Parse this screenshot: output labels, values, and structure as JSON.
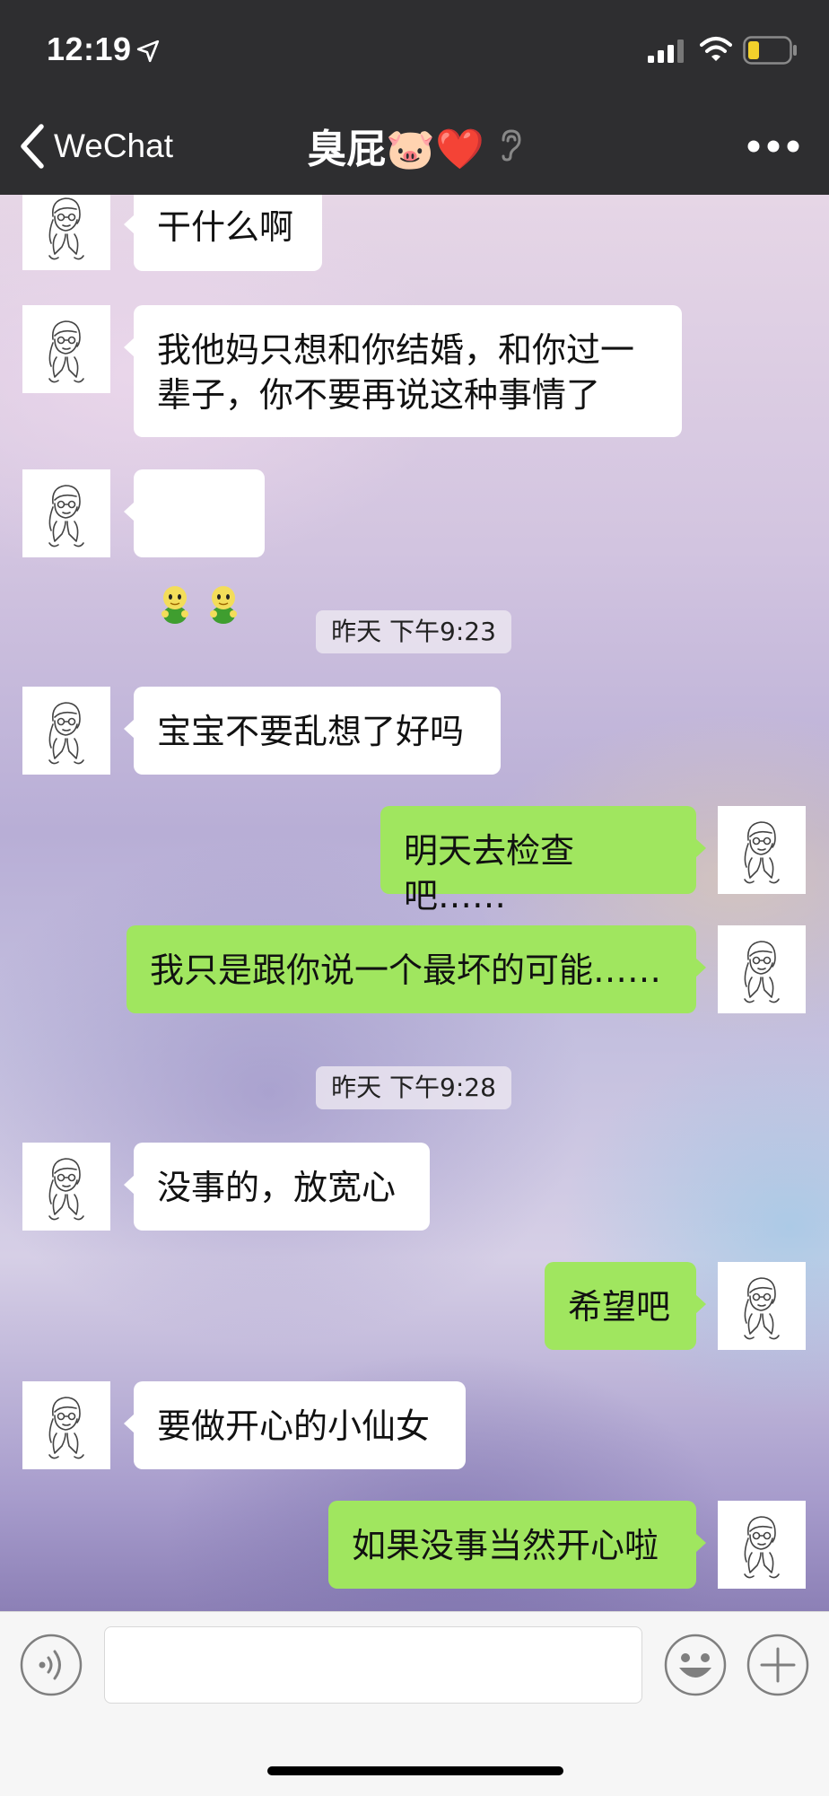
{
  "status_bar": {
    "time": "12:19",
    "icons": [
      "location-arrow-icon",
      "signal-icon",
      "wifi-icon",
      "battery-icon"
    ]
  },
  "nav": {
    "back_label": "WeChat",
    "title": "臭屁🐷❤️",
    "icons": [
      "chevron-left-icon",
      "ear-icon",
      "more-icon"
    ]
  },
  "messages": [
    {
      "side": "in",
      "text": "干什么啊"
    },
    {
      "side": "in",
      "text": "我他妈只想和你结婚，和你过一\n辈子，你不要再说这种事情了"
    },
    {
      "side": "in",
      "text": "",
      "emoji": "green-man-emoji x2"
    },
    {
      "side": "in",
      "text": "宝宝不要乱想了好吗"
    },
    {
      "side": "out",
      "text": "明天去检查吧……"
    },
    {
      "side": "out",
      "text": "我只是跟你说一个最坏的可能……"
    },
    {
      "side": "in",
      "text": "没事的，放宽心"
    },
    {
      "side": "out",
      "text": "希望吧"
    },
    {
      "side": "in",
      "text": "要做开心的小仙女"
    },
    {
      "side": "out",
      "text": "如果没事当然开心啦"
    }
  ],
  "timestamps": [
    "昨天 下午9:23",
    "昨天 下午9:28"
  ],
  "input_bar": {
    "value": "",
    "icons": [
      "voice-icon",
      "emoji-face-icon",
      "plus-icon"
    ]
  },
  "colors": {
    "nav_bg": "#2e2e30",
    "bubble_in": "#ffffff",
    "bubble_out": "#a0e65f",
    "input_bar_bg": "#f6f6f6"
  }
}
